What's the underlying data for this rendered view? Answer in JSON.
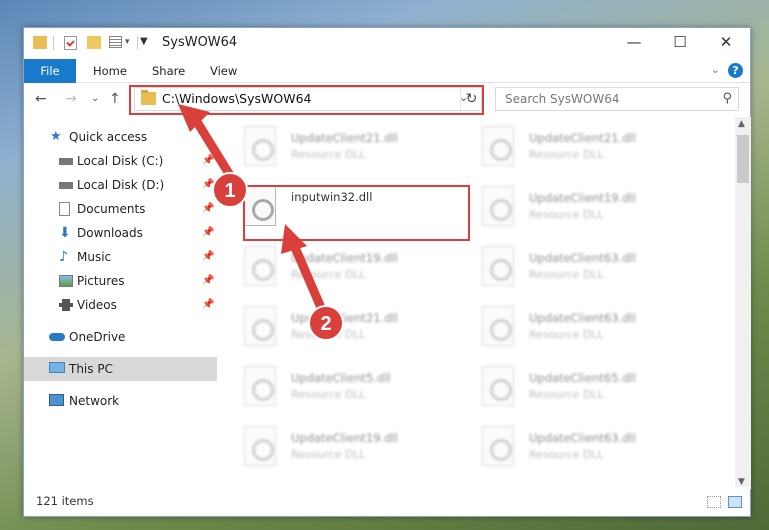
{
  "window": {
    "title": "SysWOW64"
  },
  "ribbon": {
    "tabs": [
      "File",
      "Home",
      "Share",
      "View"
    ],
    "help": "?"
  },
  "address": {
    "path": "C:\\Windows\\SysWOW64",
    "search_placeholder": "Search SysWOW64"
  },
  "sidebar": {
    "quick_access": "Quick access",
    "items": [
      "Local Disk (C:)",
      "Local Disk (D:)",
      "Documents",
      "Downloads",
      "Music",
      "Pictures",
      "Videos"
    ],
    "onedrive": "OneDrive",
    "this_pc": "This PC",
    "network": "Network"
  },
  "files": {
    "selected": {
      "name": "inputwin32.dll"
    },
    "left": [
      {
        "name": "UpdateClient21.dll",
        "type": "Resource DLL"
      },
      {
        "name": "UpdateClient19.dll",
        "type": "Resource DLL"
      },
      {
        "name": "UpdateClient21.dll",
        "type": "Resource DLL"
      },
      {
        "name": "UpdateClient5.dll",
        "type": "Resource DLL"
      },
      {
        "name": "UpdateClient19.dll",
        "type": "Resource DLL"
      }
    ],
    "right": [
      {
        "name": "UpdateClient21.dll",
        "type": "Resource DLL"
      },
      {
        "name": "UpdateClient19.dll",
        "type": "Resource DLL"
      },
      {
        "name": "UpdateClient63.dll",
        "type": "Resource DLL"
      },
      {
        "name": "UpdateClient63.dll",
        "type": "Resource DLL"
      },
      {
        "name": "UpdateClient65.dll",
        "type": "Resource DLL"
      },
      {
        "name": "UpdateClient63.dll",
        "type": "Resource DLL"
      }
    ]
  },
  "status": {
    "count": "121 items"
  },
  "callouts": [
    "1",
    "2"
  ],
  "colors": {
    "accent": "#1979ca",
    "annotation_red": "#d9403b"
  }
}
